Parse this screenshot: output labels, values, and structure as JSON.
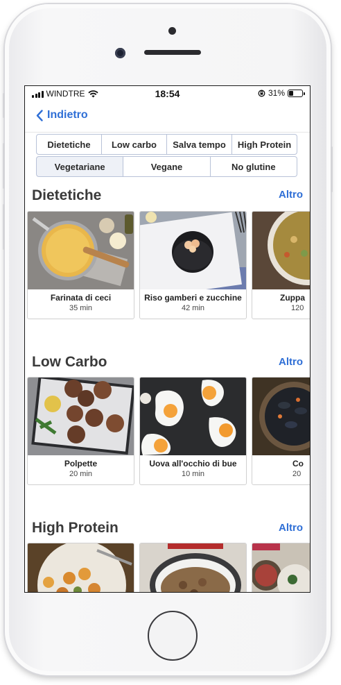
{
  "status_bar": {
    "carrier": "WINDTRE",
    "time": "18:54",
    "battery": "31%"
  },
  "nav": {
    "back_label": "Indietro"
  },
  "filters": {
    "row1": [
      "Dietetiche",
      "Low carbo",
      "Salva tempo",
      "High Protein"
    ],
    "row2": [
      "Vegetariane",
      "Vegane",
      "No glutine"
    ]
  },
  "sections": [
    {
      "title": "Dietetiche",
      "more": "Altro",
      "cards": [
        {
          "name": "Farinata di ceci",
          "time": "35 min"
        },
        {
          "name": "Riso gamberi e zucchine",
          "time": "42 min"
        },
        {
          "name": "Zuppa",
          "time": "120"
        }
      ]
    },
    {
      "title": "Low Carbo",
      "more": "Altro",
      "cards": [
        {
          "name": "Polpette",
          "time": "20 min"
        },
        {
          "name": "Uova all'occhio di bue",
          "time": "10 min"
        },
        {
          "name": "Co",
          "time": "20"
        }
      ]
    },
    {
      "title": "High Protein",
      "more": "Altro"
    }
  ],
  "colors": {
    "accent": "#2f6fd6",
    "chip_border": "#b8c2d8"
  }
}
